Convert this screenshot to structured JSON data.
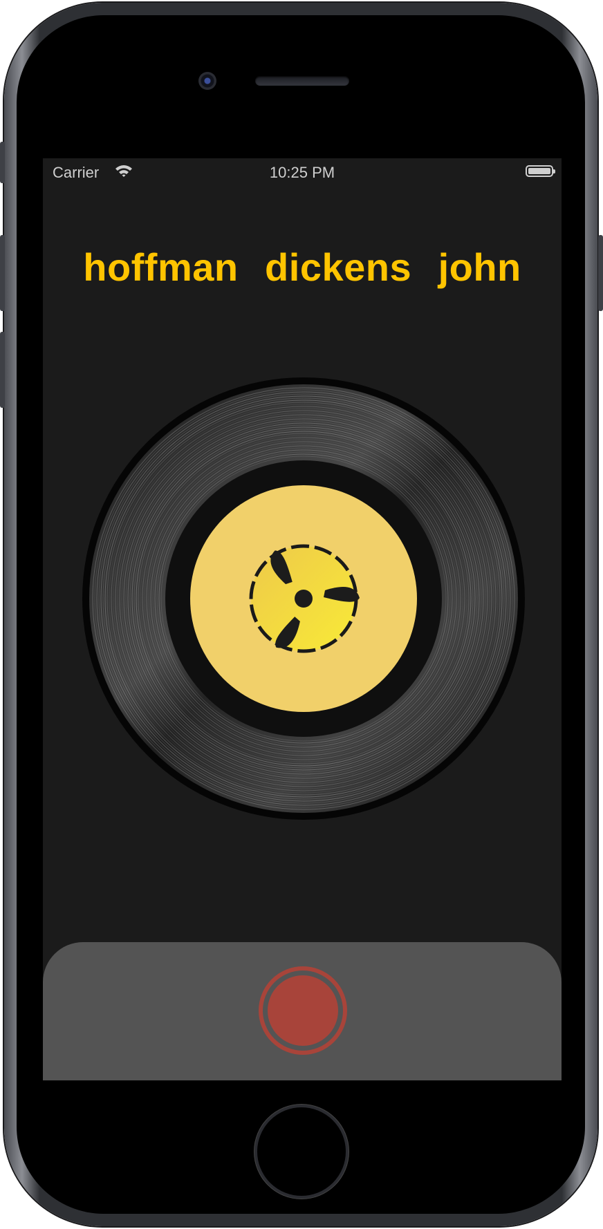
{
  "status_bar": {
    "carrier": "Carrier",
    "time": "10:25 PM",
    "wifi_icon": "wifi-icon",
    "battery_icon": "battery-full-icon"
  },
  "words": [
    "hoffman",
    "dickens",
    "john"
  ],
  "record": {
    "label_icon": "45-rpm-adapter-icon",
    "label_color": "#f1d06a",
    "adapter_color": "#f6e23b"
  },
  "record_button": {
    "icon": "record-icon",
    "color": "#a8443a"
  },
  "colors": {
    "accent": "#ffc400",
    "screen_background": "#1b1b1b",
    "panel_background": "#545454"
  }
}
